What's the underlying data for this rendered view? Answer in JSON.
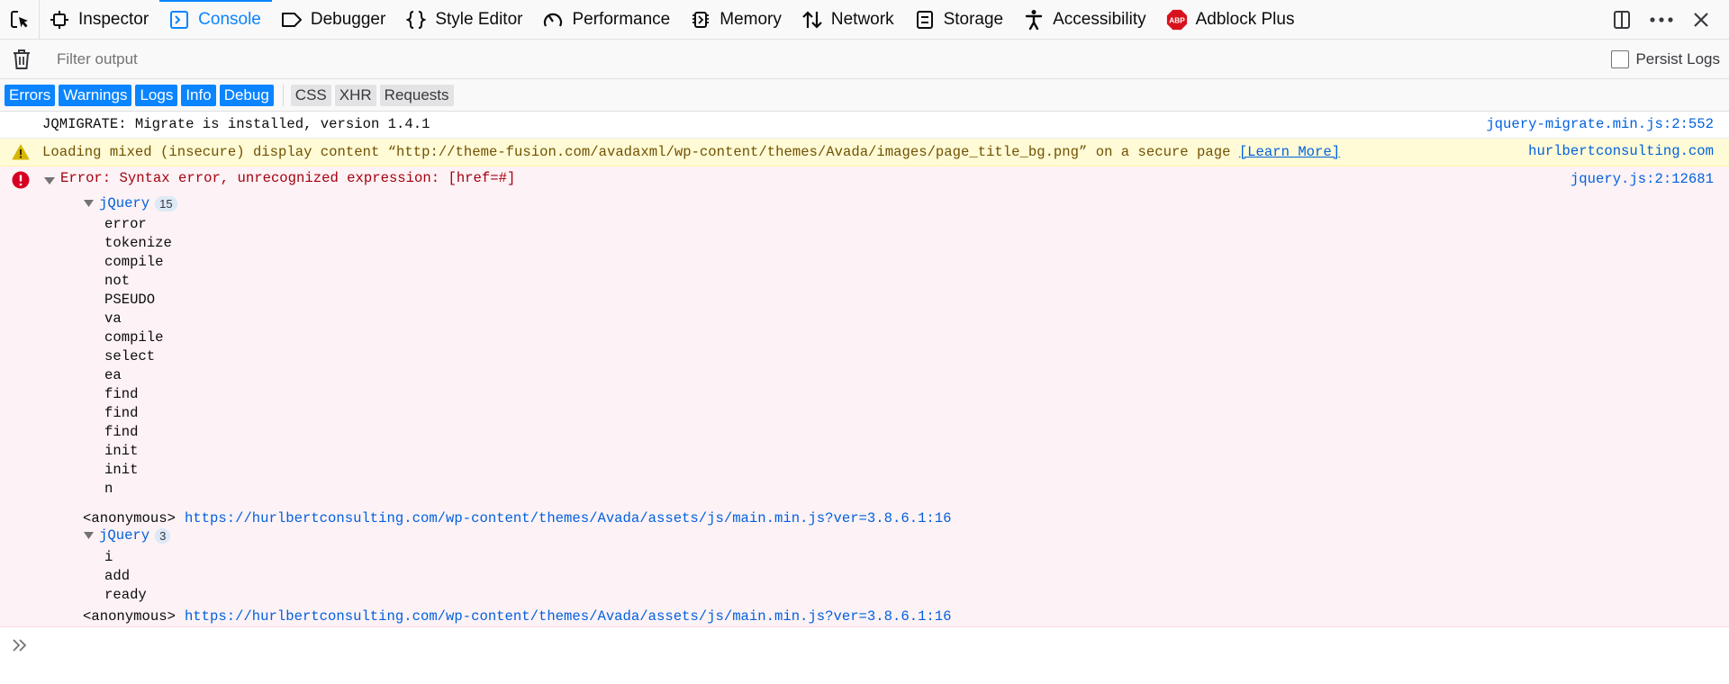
{
  "toolbar": {
    "tabs": [
      {
        "label": "Inspector",
        "icon": "inspector-icon"
      },
      {
        "label": "Console",
        "icon": "console-icon",
        "active": true
      },
      {
        "label": "Debugger",
        "icon": "debugger-icon"
      },
      {
        "label": "Style Editor",
        "icon": "style-editor-icon"
      },
      {
        "label": "Performance",
        "icon": "performance-icon"
      },
      {
        "label": "Memory",
        "icon": "memory-icon"
      },
      {
        "label": "Network",
        "icon": "network-icon"
      },
      {
        "label": "Storage",
        "icon": "storage-icon"
      },
      {
        "label": "Accessibility",
        "icon": "accessibility-icon"
      },
      {
        "label": "Adblock Plus",
        "icon": "adblock-plus-icon"
      }
    ],
    "right_icons": [
      "dock-icon",
      "more-icon",
      "close-icon"
    ],
    "accent": "#0a84ff"
  },
  "filterbar": {
    "placeholder": "Filter output",
    "persist_label": "Persist Logs",
    "persist_checked": false
  },
  "categories": {
    "active": [
      "Errors",
      "Warnings",
      "Logs",
      "Info",
      "Debug"
    ],
    "inactive": [
      "CSS",
      "XHR",
      "Requests"
    ]
  },
  "messages": {
    "log": {
      "text": "JQMIGRATE: Migrate is installed, version 1.4.1",
      "source": "jquery-migrate.min.js:2:552"
    },
    "warning": {
      "text": "Loading mixed (insecure) display content “http://theme-fusion.com/avadaxml/wp-content/themes/Avada/images/page_title_bg.png” on a secure page",
      "link": "[Learn More]",
      "source": "hurlbertconsulting.com"
    },
    "error": {
      "headline": "Error: Syntax error, unrecognized expression: [href=#]",
      "source": "jquery.js:2:12681",
      "group1": {
        "name": "jQuery",
        "count": "15",
        "frames": [
          "error",
          "tokenize",
          "compile",
          "not",
          "PSEUDO",
          "va",
          "compile",
          "select",
          "ea",
          "find",
          "find",
          "find",
          "init",
          "init",
          "n"
        ]
      },
      "anon1": {
        "label": "<anonymous>",
        "url": "https://hurlbertconsulting.com/wp-content/themes/Avada/assets/js/main.min.js?ver=3.8.6.1:16"
      },
      "group2": {
        "name": "jQuery",
        "count": "3",
        "frames": [
          "i",
          "add",
          "ready"
        ]
      },
      "anon2": {
        "label": "<anonymous>",
        "url": "https://hurlbertconsulting.com/wp-content/themes/Avada/assets/js/main.min.js?ver=3.8.6.1:16"
      }
    }
  }
}
